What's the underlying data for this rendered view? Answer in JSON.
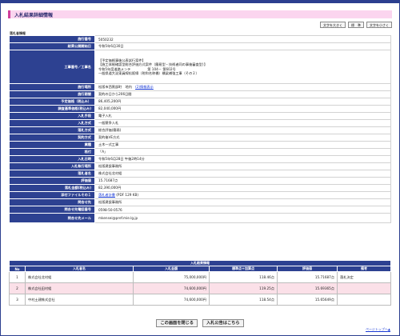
{
  "page": {
    "title": "入札結果詳細情報",
    "section_label": "落札者情報"
  },
  "font_buttons": [
    "文字を大きく",
    "標　準",
    "文字を小さく"
  ],
  "info_rows": [
    {
      "label": "施行番号",
      "value": "5050232"
    },
    {
      "label": "結果公開開始日",
      "value": "令和5年6月30日"
    },
    {
      "label": "工事番号／工事名",
      "lines": [
        "【予定価格事後公表試行案件】",
        "【施工体制確認型総合評価方式案件（簡易型・技術者同の事後審査型）】",
        "令和5年度道路メンテ　　　　　第 104－ 第602号",
        "一般県道大淀東員線松阪線（射和名称橋）橋梁補強工事（その２）"
      ]
    },
    {
      "label": "施行場所",
      "value": "松阪市西黒部町　地内",
      "link": "(2)情報表示"
    },
    {
      "label": "施行期間",
      "value": "契約の日から206日間"
    },
    {
      "label": "予定価格（税込み）",
      "value": "86,405,200円"
    },
    {
      "label": "調査基準価格(税込み)",
      "value": "82,040,000円"
    },
    {
      "label": "入札手段",
      "value": "電子入札"
    },
    {
      "label": "入札方式",
      "value": "一般競争入札"
    },
    {
      "label": "落札方式",
      "value": "総合評価(簡易)"
    },
    {
      "label": "契約方式",
      "value": "契約後VE方式"
    },
    {
      "label": "業種",
      "value": "土木一式工事"
    },
    {
      "label": "格付",
      "value": "「A」"
    },
    {
      "label": "入札日時",
      "value": "令和5年6月28日 午後2時14分"
    },
    {
      "label": "入札執行場所",
      "value": "松阪建設事務所"
    },
    {
      "label": "落札者名",
      "value": "株式会社北村組"
    },
    {
      "label": "評価値",
      "value": "15.71687点"
    },
    {
      "label": "落札金額(税込み)",
      "value": "82,390,000円"
    },
    {
      "label": "添付ファイルその１",
      "link": "落札者計書",
      "value": "(PDF 129 KB)"
    },
    {
      "label": "問合せ先",
      "value": "松阪建設事務所"
    },
    {
      "label": "問合せ先電話番号",
      "value": "0598-50-0576"
    },
    {
      "label": "問合せ先メール",
      "value": "mkensei@pref.mie.lg.jp"
    }
  ],
  "results": {
    "caption": "入札結果情報",
    "headers": [
      "No",
      "入札者名",
      "入札金額",
      "標準点＋加算点",
      "評価値",
      "備考"
    ],
    "rows": [
      {
        "no": "1",
        "name": "株式会社北村組",
        "amount": "75,000,000円",
        "score": "118.46点",
        "eval": "15.71687点",
        "note": "落札決定",
        "pink": false
      },
      {
        "no": "2",
        "name": "株式会社田村組",
        "amount": "74,600,000円",
        "score": "119.25点",
        "eval": "15.69365点",
        "note": "",
        "pink": true
      },
      {
        "no": "3",
        "name": "中村土建株式会社",
        "amount": "74,600,000円",
        "score": "118.54点",
        "eval": "15.65649点",
        "note": "",
        "pink": false
      }
    ]
  },
  "bottom_buttons": [
    "この画面を閉じる",
    "入札公告はこちら"
  ],
  "page_top": "ページトップへ"
}
